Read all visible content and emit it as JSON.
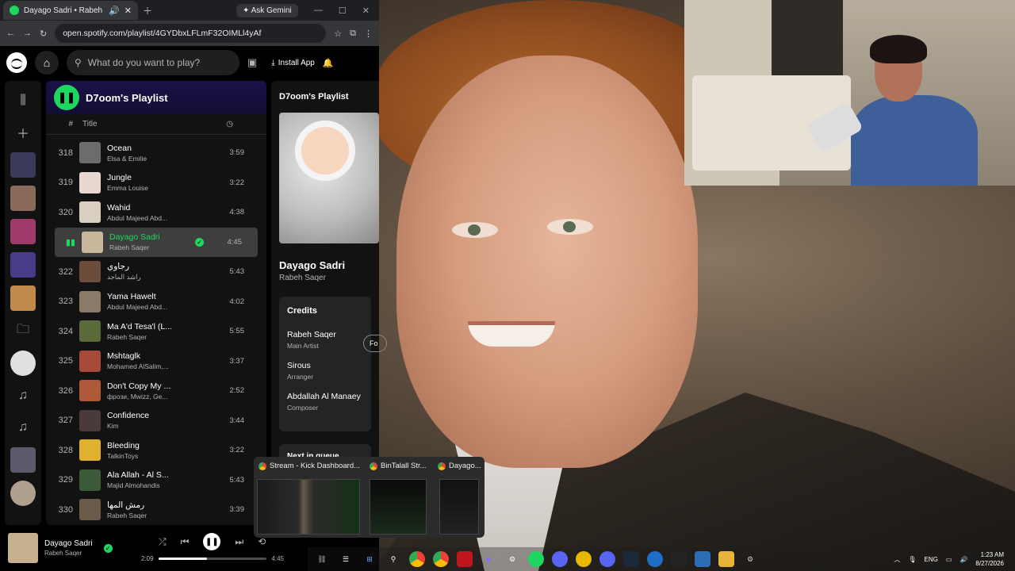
{
  "browser": {
    "tab_title": "Dayago Sadri • Rabeh Saq",
    "ask_gemini": "Ask Gemini",
    "url": "open.spotify.com/playlist/4GYDbxLFLmF32OIMLl4yAf"
  },
  "spotify": {
    "search_placeholder": "What do you want to play?",
    "install_app": "Install App",
    "playlist_title": "D7oom's Playlist",
    "col_num": "#",
    "col_title": "Title",
    "tracks": [
      {
        "num": "318",
        "title": "Ocean",
        "artist": "Elsa & Emilie",
        "dur": "3:59",
        "color": "#6c6c6c"
      },
      {
        "num": "319",
        "title": "Jungle",
        "artist": "Emma Louise",
        "dur": "3:22",
        "color": "#e8d8cf"
      },
      {
        "num": "320",
        "title": "Wahid",
        "artist": "Abdul Majeed Abd...",
        "dur": "4:38",
        "color": "#d9cfc0"
      },
      {
        "num": "",
        "title": "Dayago Sadri",
        "artist": "Rabeh Saqer",
        "dur": "4:45",
        "color": "#c9b79b",
        "active": true
      },
      {
        "num": "322",
        "title": "رجاوي",
        "artist": "راشد الماجد",
        "dur": "5:43",
        "color": "#6b4b3a"
      },
      {
        "num": "323",
        "title": "Yama Hawelt",
        "artist": "Abdul Majeed Abd...",
        "dur": "4:02",
        "color": "#8a7a6a"
      },
      {
        "num": "324",
        "title": "Ma A'd Tesa'l (L...",
        "artist": "Rabeh Saqer",
        "dur": "5:55",
        "color": "#5a6a3a"
      },
      {
        "num": "325",
        "title": "Mshtaglk",
        "artist": "Mohamed AlSalim,...",
        "dur": "3:37",
        "color": "#a74a3a"
      },
      {
        "num": "326",
        "title": "Don't Copy My ...",
        "artist": "фрози, Mwizz, Ge...",
        "dur": "2:52",
        "color": "#b0583a"
      },
      {
        "num": "327",
        "title": "Confidence",
        "artist": "Kim",
        "dur": "3:44",
        "color": "#4a3a3a"
      },
      {
        "num": "328",
        "title": "Bleeding",
        "artist": "TalkinToys",
        "dur": "3:22",
        "color": "#e0b030"
      },
      {
        "num": "329",
        "title": "Ala Allah - Al S...",
        "artist": "Majid Almohandis",
        "dur": "5:43",
        "color": "#3a5a3a"
      },
      {
        "num": "330",
        "title": "رمش المها",
        "artist": "Rabeh Saqer",
        "dur": "3:39",
        "color": "#6a5a4a"
      }
    ],
    "now_playing_panel": {
      "header": "D7oom's Playlist",
      "song": "Dayago Sadri",
      "artist": "Rabeh Saqer",
      "credits_title": "Credits",
      "credits": [
        {
          "name": "Rabeh Saqer",
          "role": "Main Artist"
        },
        {
          "name": "Sirous",
          "role": "Arranger"
        },
        {
          "name": "Abdallah Al Manaey",
          "role": "Composer"
        }
      ],
      "follow": "Fo",
      "next_in_queue": "Next in queue"
    },
    "player": {
      "song": "Dayago Sadri",
      "artist": "Rabeh Saqer",
      "elapsed": "2:09",
      "total": "4:45",
      "progress": 0.45
    }
  },
  "popup": {
    "items": [
      {
        "title": "Stream - Kick Dashboard..."
      },
      {
        "title": "BinTalall Str..."
      },
      {
        "title": "Dayago..."
      }
    ]
  },
  "taskbar": {
    "lang": "ENG",
    "time": "1:23 AM",
    "date": "8/27/2026"
  }
}
